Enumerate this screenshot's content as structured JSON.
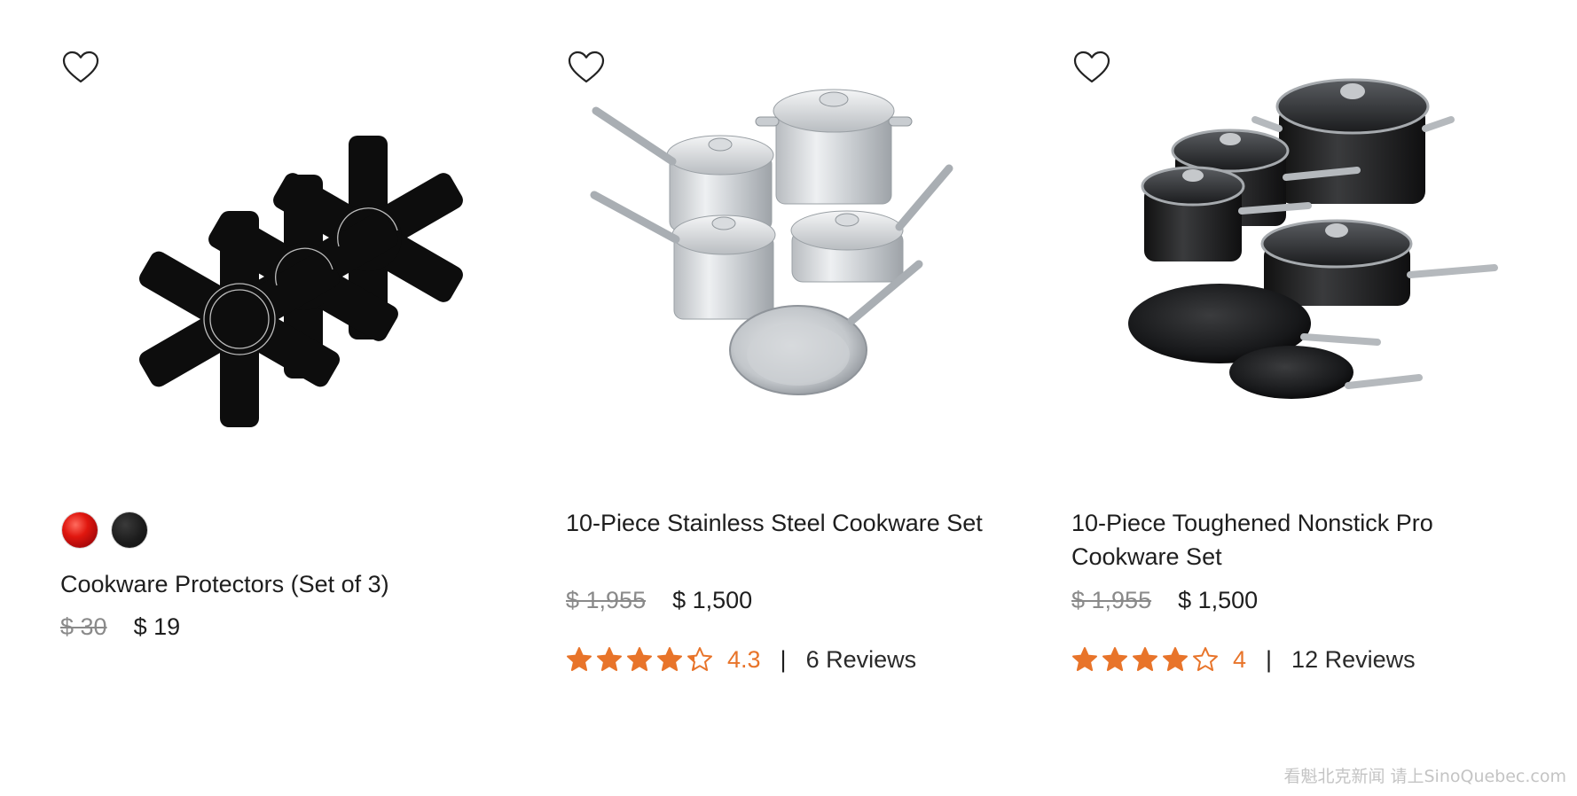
{
  "products": [
    {
      "title": "Cookware Protectors (Set of 3)",
      "price_old": "$ 30",
      "price_new": "$ 19",
      "swatches": [
        {
          "name": "red",
          "color": "#d3150e"
        },
        {
          "name": "black",
          "color": "#1c1c1c"
        }
      ],
      "image_icon": "cookware-protectors-image"
    },
    {
      "title": "10-Piece Stainless Steel Cookware Set",
      "price_old": "$ 1,955",
      "price_new": "$ 1,500",
      "rating": 4.3,
      "rating_label": "4.3",
      "reviews_label": "6 Reviews",
      "image_icon": "stainless-cookware-set-image"
    },
    {
      "title": "10-Piece Toughened Nonstick Pro Cookware Set",
      "price_old": "$ 1,955",
      "price_new": "$ 1,500",
      "rating": 4,
      "rating_label": "4",
      "reviews_label": "12 Reviews",
      "image_icon": "nonstick-cookware-set-image"
    }
  ],
  "rating_separator": "|",
  "watermark": "看魁北克新闻 请上SinoQuebec.com",
  "colors": {
    "star": "#e8742a",
    "price_old": "#8a8a8a",
    "text": "#1e1e1e"
  }
}
